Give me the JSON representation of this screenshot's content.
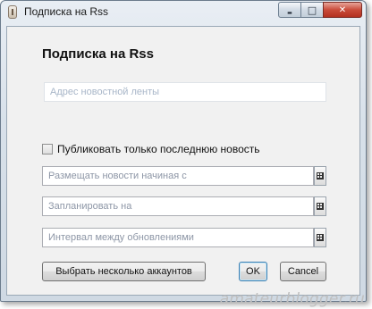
{
  "window": {
    "title": "Подписка на Rss",
    "controls": {
      "minimize": "▬",
      "maximize": "□",
      "close": "✕"
    }
  },
  "dialog": {
    "heading": "Подписка на Rss",
    "feed_url": {
      "placeholder": "Адрес новостной ленты",
      "value": ""
    },
    "latest_only": {
      "label": "Публиковать только последнюю новость",
      "checked": false
    },
    "start_date": {
      "placeholder": "Размещать новости начиная с"
    },
    "schedule": {
      "placeholder": "Запланировать на"
    },
    "interval": {
      "placeholder": "Интервал между обновлениями"
    },
    "buttons": {
      "select_accounts": "Выбрать несколько аккаунтов",
      "ok": "OK",
      "cancel": "Cancel"
    }
  },
  "watermark": "amateurblogger.ru",
  "icons": [
    "app-icon",
    "calendar-icon",
    "minimize-icon",
    "maximize-icon",
    "close-icon"
  ]
}
